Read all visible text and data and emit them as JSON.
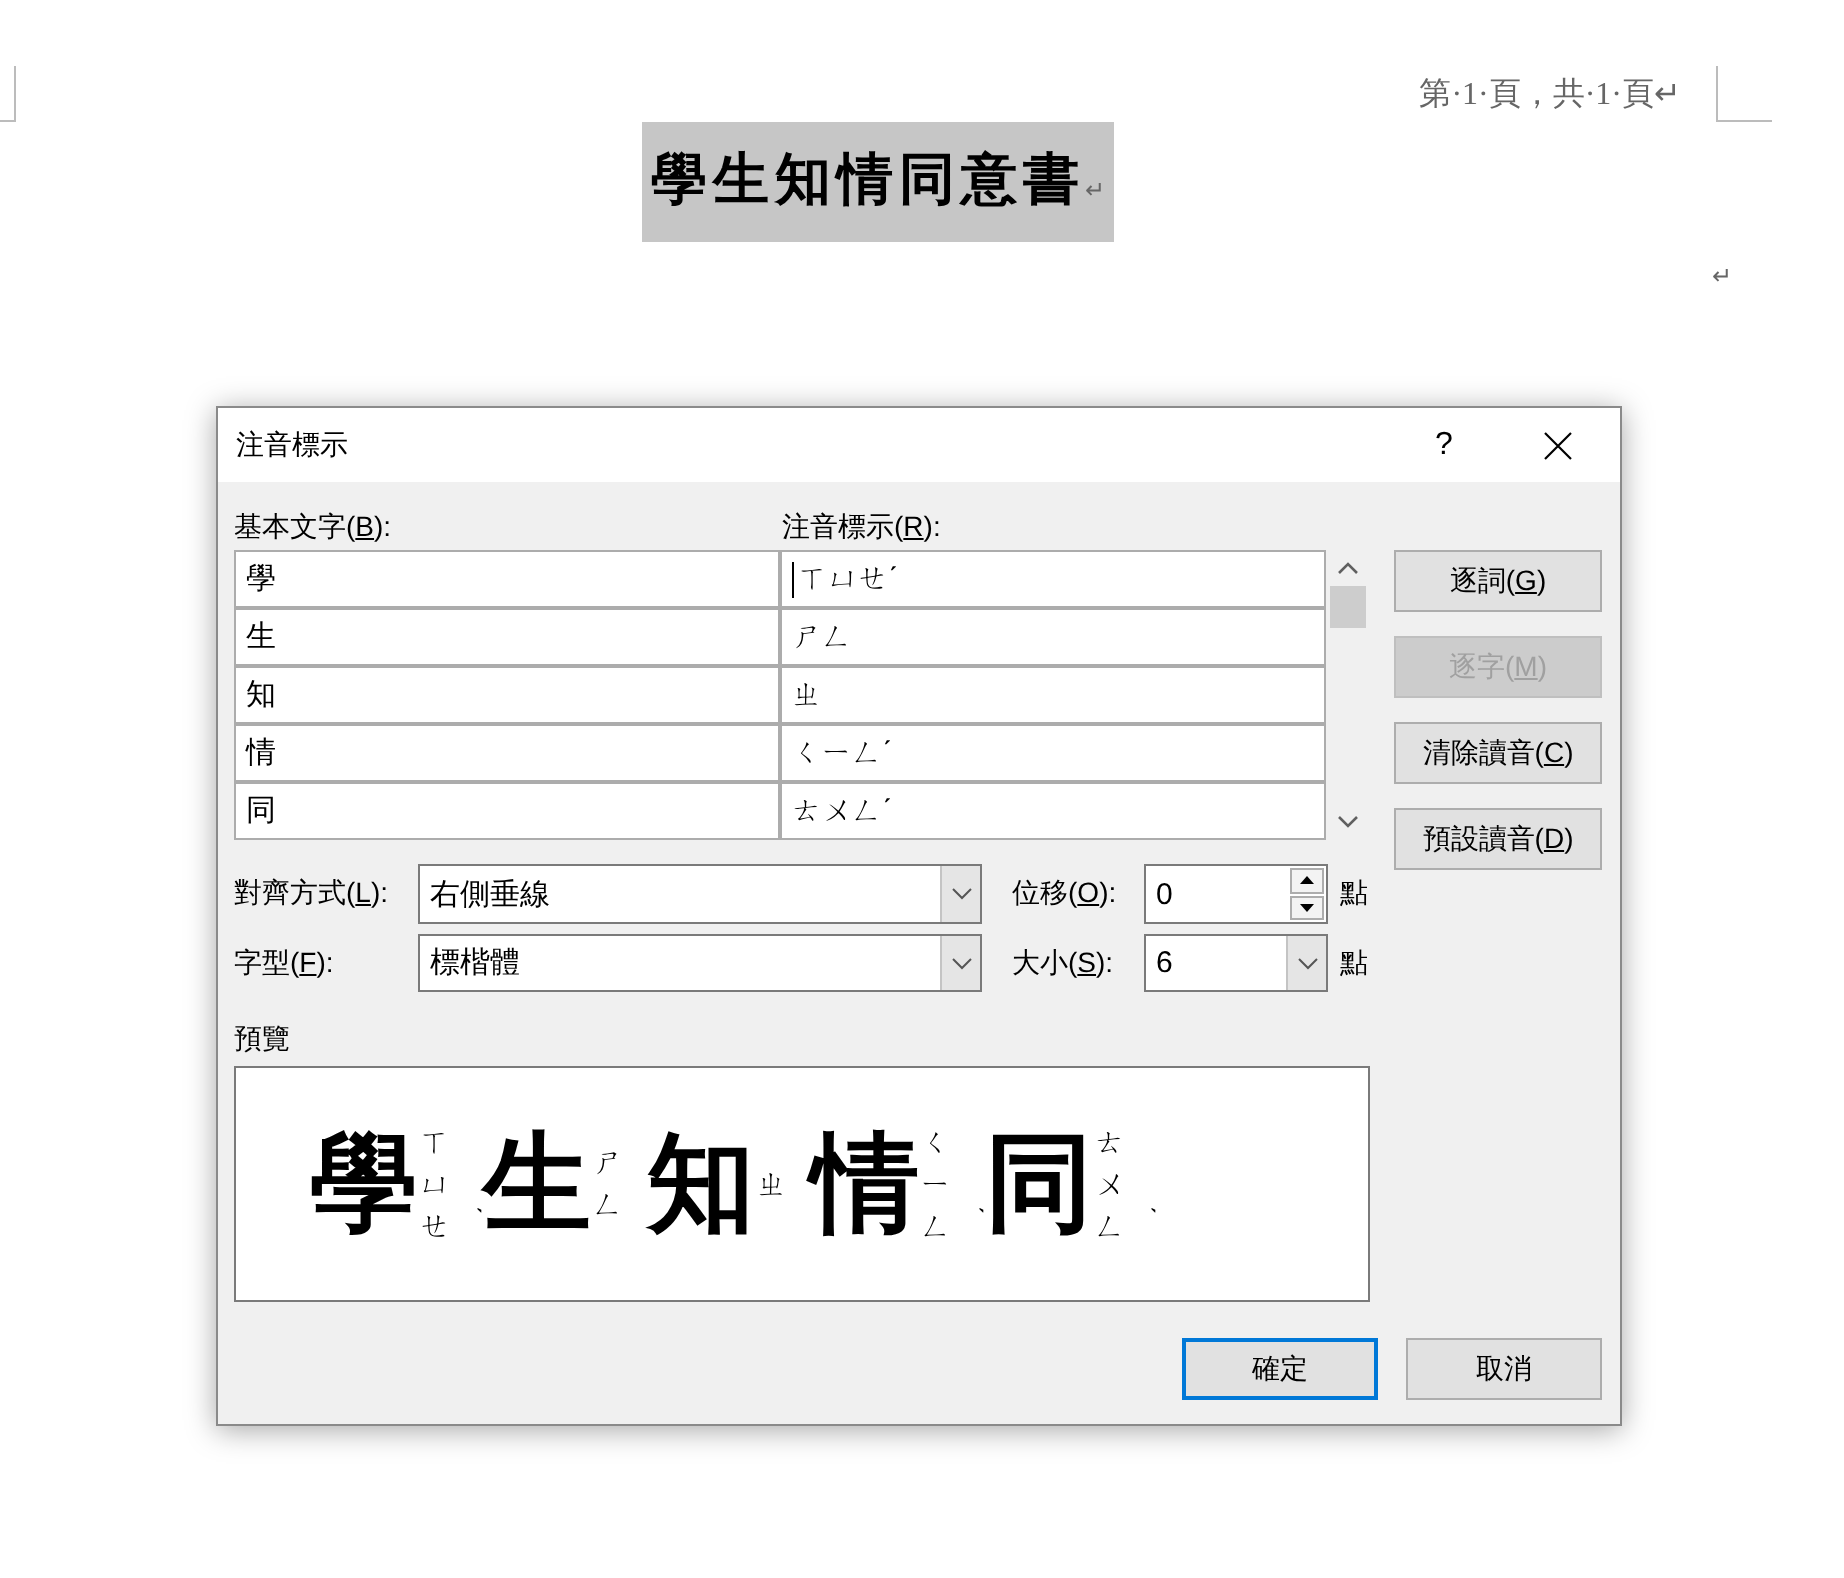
{
  "document": {
    "header": "第·1·頁，共·1·頁↵",
    "title": {
      "text": "學生知情同意書",
      "mark": "↵",
      "selected": true
    },
    "end_mark": "↵"
  },
  "dialog": {
    "title": "注音標示",
    "help": "?",
    "column_labels": [
      {
        "before": "基本文字(",
        "key": "B",
        "after": "):"
      },
      {
        "before": "注音標示(",
        "key": "R",
        "after": "):"
      }
    ],
    "rows": [
      {
        "base": "學",
        "ruby": "ㄒㄩㄝˊ",
        "cursor": true
      },
      {
        "base": "生",
        "ruby": "ㄕㄥ",
        "cursor": false
      },
      {
        "base": "知",
        "ruby": "ㄓ",
        "cursor": false
      },
      {
        "base": "情",
        "ruby": "ㄑㄧㄥˊ",
        "cursor": false
      },
      {
        "base": "同",
        "ruby": "ㄊㄨㄥˊ",
        "cursor": false
      }
    ],
    "side_buttons": [
      {
        "before": "逐詞(",
        "key": "G",
        "after": ")",
        "disabled": false
      },
      {
        "before": "逐字(",
        "key": "M",
        "after": ")",
        "disabled": true
      },
      {
        "before": "清除讀音(",
        "key": "C",
        "after": ")",
        "disabled": false
      },
      {
        "before": "預設讀音(",
        "key": "D",
        "after": ")",
        "disabled": false
      }
    ],
    "alignment": {
      "label": {
        "before": "對齊方式(",
        "key": "L",
        "after": "):"
      },
      "value": "右側垂線"
    },
    "offset": {
      "label": {
        "before": "位移(",
        "key": "O",
        "after": "):"
      },
      "value": "0",
      "unit": "點"
    },
    "font": {
      "label": {
        "before": "字型(",
        "key": "F",
        "after": "):"
      },
      "value": "標楷體"
    },
    "size": {
      "label": {
        "before": "大小(",
        "key": "S",
        "after": "):"
      },
      "value": "6",
      "unit": "點"
    },
    "preview": {
      "label": "預覽",
      "items": [
        {
          "base": "學",
          "zhuyin": "ㄒㄩㄝ",
          "tone": "ˊ"
        },
        {
          "base": "生",
          "zhuyin": "ㄕㄥ"
        },
        {
          "base": "知",
          "zhuyin": "ㄓ"
        },
        {
          "base": "情",
          "zhuyin": "ㄑㄧㄥ",
          "tone": "ˊ"
        },
        {
          "base": "同",
          "zhuyin": "ㄊㄨㄥ",
          "tone": "ˊ"
        }
      ]
    },
    "buttons": [
      {
        "label": "確定",
        "default": true
      },
      {
        "label": "取消",
        "default": false
      }
    ]
  }
}
